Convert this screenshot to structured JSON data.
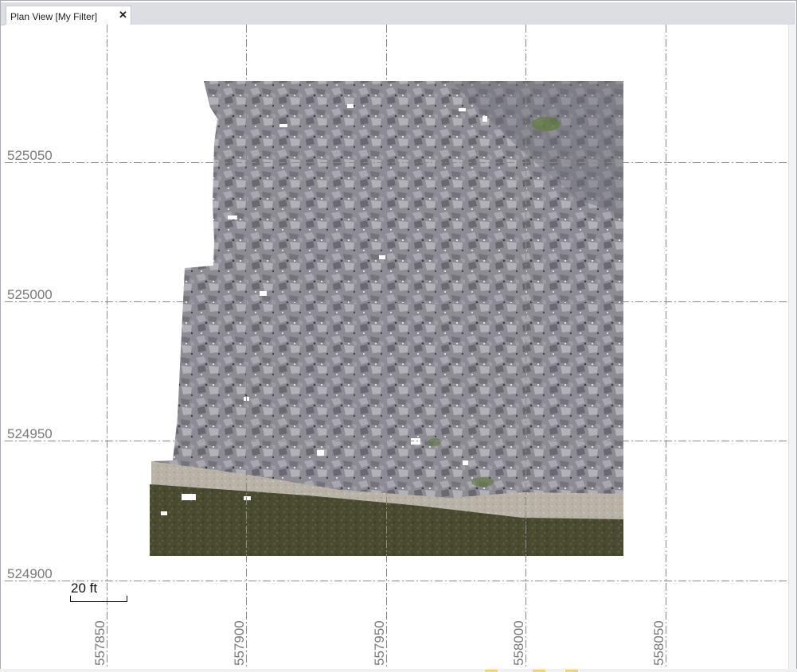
{
  "window": {
    "tab_title": "Plan View [My Filter]",
    "close_glyph": "✕"
  },
  "map": {
    "grid_style": "dash-dot",
    "grid_color": "#8a8a8a",
    "northing_labels": [
      "525050",
      "525000",
      "524950",
      "524900"
    ],
    "easting_labels": [
      "557850",
      "557900",
      "557950",
      "558000",
      "558050"
    ],
    "scale_bar_label": "20 ft",
    "layer": "orthomosaic-rock-surface",
    "colors": {
      "rock": "#8c8b93",
      "rock_dark": "#5f5e66",
      "gravel_strip": "#b8b2a6",
      "grass": "#4c4b32",
      "vegetation_spot": "#5f7a3a"
    }
  }
}
